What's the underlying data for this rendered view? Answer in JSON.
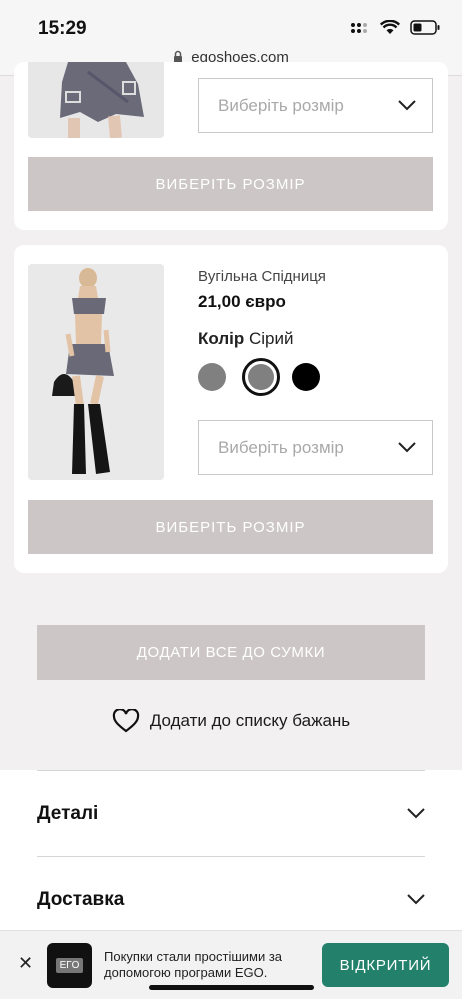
{
  "status_bar": {
    "time": "15:29",
    "url": "egoshoes.com"
  },
  "product_top": {
    "size_placeholder": "Виберіть розмір",
    "button_label": "ВИБЕРІТЬ РОЗМІР"
  },
  "product_main": {
    "name": "Вугільна Спідниця",
    "price": "21,00 євро",
    "color_label": "Колір",
    "color_value": "Сірий",
    "swatches": [
      "#808080",
      "#808080",
      "#000000"
    ],
    "size_placeholder": "Виберіть розмір",
    "button_label": "ВИБЕРІТЬ РОЗМІР"
  },
  "actions": {
    "add_all": "ДОДАТИ ВСЕ ДО СУМКИ",
    "wishlist": "Додати до списку бажань"
  },
  "accordion": {
    "details": "Деталі",
    "delivery": "Доставка"
  },
  "app_banner": {
    "logo_text": "EГO",
    "text": "Покупки стали простішими за допомогою програми EGO.",
    "open_button": "ВІДКРИТИЙ"
  }
}
